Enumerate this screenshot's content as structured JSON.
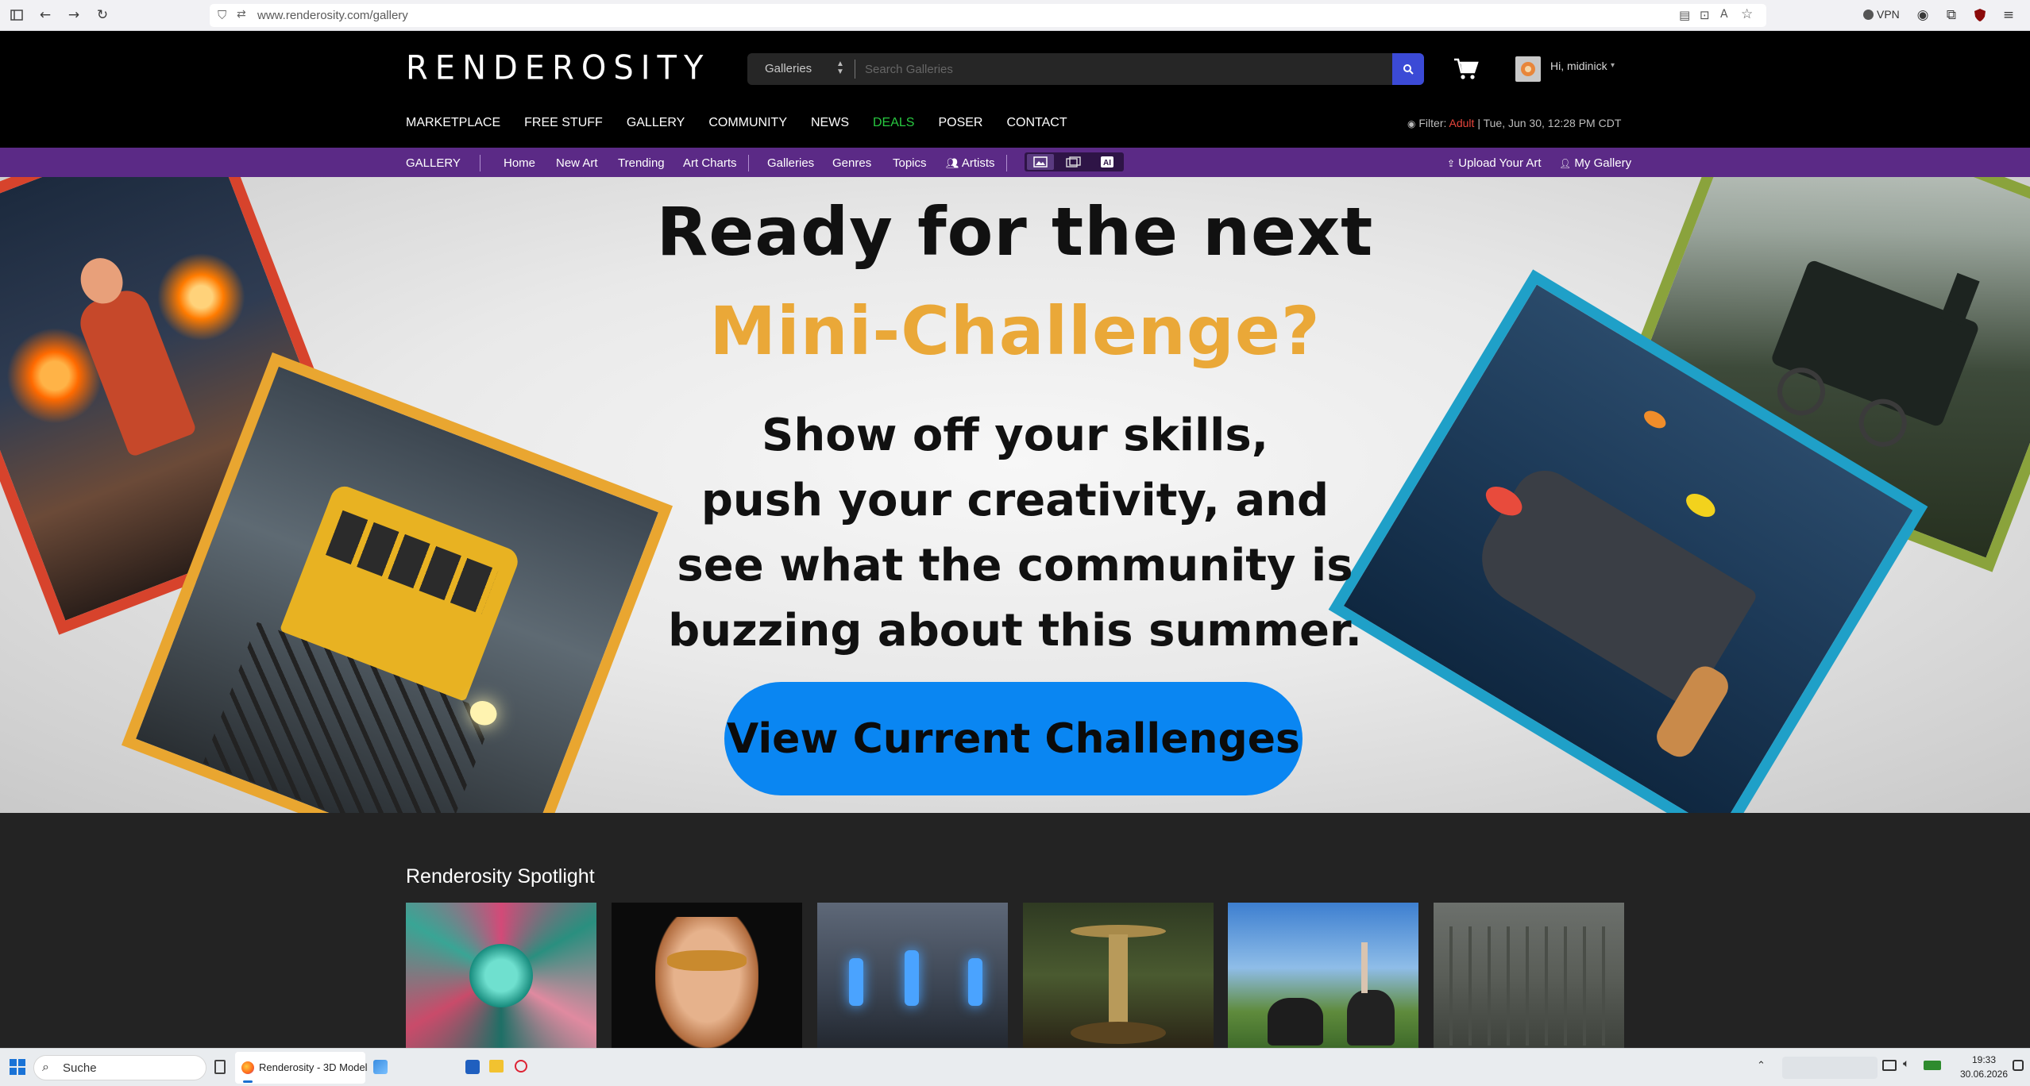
{
  "browser": {
    "url": "www.renderosity.com/gallery",
    "vpn_label": "VPN"
  },
  "header": {
    "logo_text": "RENDEROSITY",
    "search_category": "Galleries",
    "search_placeholder": "Search Galleries",
    "greeting": "Hi, midinick",
    "nav_items": [
      "MARKETPLACE",
      "FREE STUFF",
      "GALLERY",
      "COMMUNITY",
      "NEWS",
      "DEALS",
      "POSER",
      "CONTACT"
    ],
    "filter_prefix": "Filter:",
    "filter_value": "Adult",
    "datetime": "| Tue, Jun 30, 12:28 PM CDT"
  },
  "gallery_nav": {
    "section_label": "GALLERY",
    "items": [
      "Home",
      "New Art",
      "Trending",
      "Art Charts",
      "Galleries",
      "Genres",
      "Topics",
      "Artists"
    ],
    "upload_label": "Upload Your Art",
    "my_gallery_label": "My Gallery"
  },
  "hero": {
    "line1": "Ready for the next",
    "line2": "Mini-Challenge?",
    "body_lines": [
      "Show off your skills,",
      "push your creativity, and",
      "see what the community is",
      "buzzing about this  summer."
    ],
    "cta_label": "View Current Challenges"
  },
  "spotlight": {
    "title": "Renderosity Spotlight"
  },
  "taskbar": {
    "search_label": "Suche",
    "app_label": "Renderosity - 3D Model",
    "time": "19:33",
    "date": "30.06.2026"
  },
  "colors": {
    "purple_nav": "#5b2a86",
    "deals_green": "#28c840",
    "search_blue": "#3b4ad6",
    "cta_blue": "#0a86f2",
    "title_gold": "#eaa838"
  }
}
